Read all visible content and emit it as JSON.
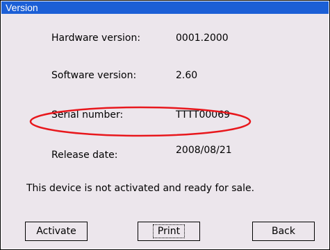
{
  "window": {
    "title": "Version"
  },
  "info": {
    "hardware_label": "Hardware version:",
    "hardware_value": "0001.2000",
    "software_label": "Software version:",
    "software_value": "2.60",
    "serial_label": "Serial number:",
    "serial_value": "TTTT00069",
    "release_label": "Release date:",
    "release_value": "2008/08/21"
  },
  "status_message": "This device is not activated and ready for sale.",
  "buttons": {
    "activate": "Activate",
    "print": "Print",
    "back": "Back"
  },
  "colors": {
    "titlebar": "#1c5fd6",
    "background": "#ece6ec",
    "highlight_ellipse": "#e8171c"
  }
}
